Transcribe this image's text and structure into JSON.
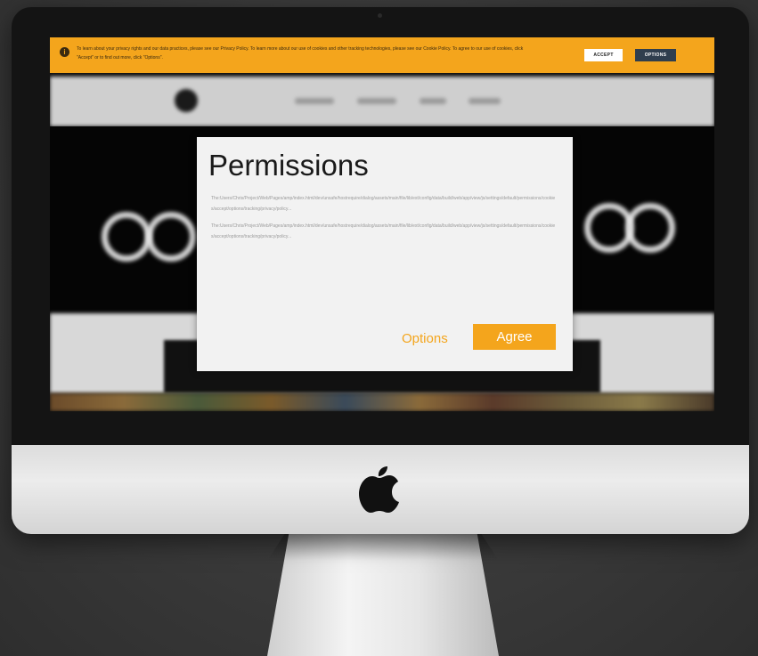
{
  "cookie_banner": {
    "text": "To learn about your privacy rights and our data practices, please see our Privacy Policy. To learn more about our use of cookies and other tracking technologies, please see our Cookie Policy. To agree to our use of cookies, click \"Accept\" or to find out more, click \"Options\".",
    "accept_label": "ACCEPT",
    "options_label": "OPTIONS",
    "info_icon": "i"
  },
  "modal": {
    "title": "Permissions",
    "paragraphs": [
      "The:Users/Chris/Project/Web/Pages/amp/index.html/dev/unsafe/hostrequire/dialog/assets/main/file/lib/ext/config/data/build/web/app/view/js/settings/default/permissions/cookies/accept/options/tracking/privacy/policy...",
      "The:Users/Chris/Project/Web/Pages/amp/index.html/dev/unsafe/hostrequire/dialog/assets/main/file/lib/ext/config/data/build/web/app/view/js/settings/default/permissions/cookies/accept/options/tracking/privacy/policy..."
    ],
    "options_label": "Options",
    "agree_label": "Agree"
  },
  "colors": {
    "accent": "#f4a51c",
    "options_button": "#2f3e4e",
    "modal_bg": "#f2f2f2"
  }
}
